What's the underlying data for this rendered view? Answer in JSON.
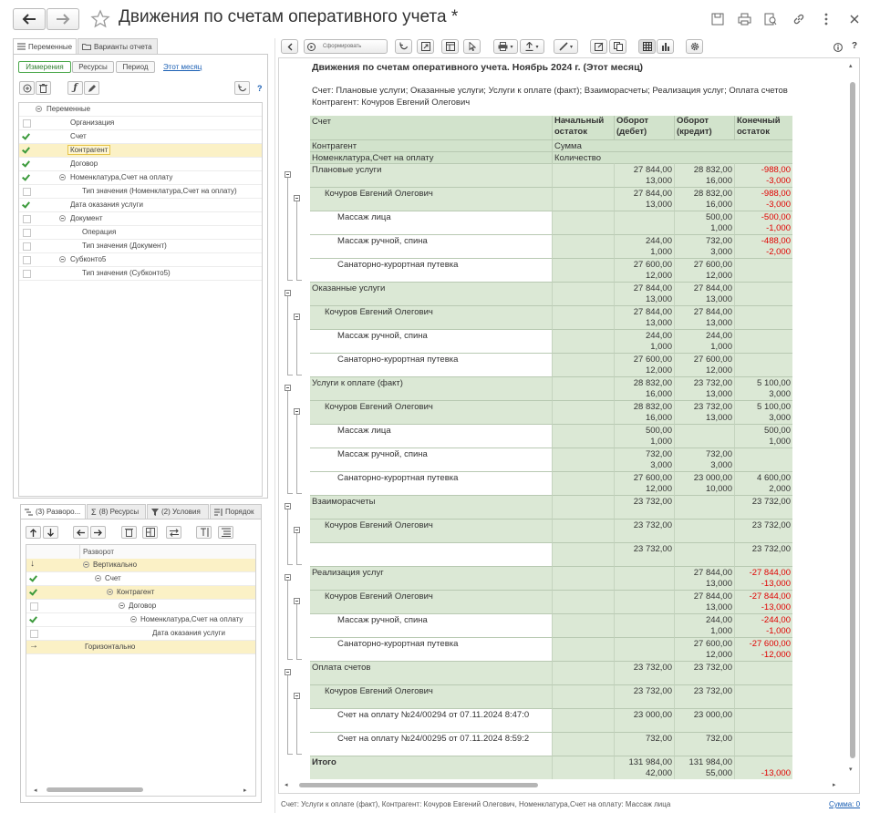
{
  "window": {
    "title": "Движения по счетам оперативного учета *"
  },
  "left_panel": {
    "tabs": [
      "Переменные",
      "Варианты отчета"
    ],
    "subtabs": [
      "Измерения",
      "Ресурсы",
      "Период"
    ],
    "period_link": "Этот месяц",
    "help": "?",
    "tree": [
      {
        "label": "Переменные",
        "level": 0,
        "checked": null,
        "group": true
      },
      {
        "label": "Организация",
        "level": 1,
        "checked": false
      },
      {
        "label": "Счет",
        "level": 1,
        "checked": true
      },
      {
        "label": "Контрагент",
        "level": 1,
        "checked": true,
        "highlight": true
      },
      {
        "label": "Договор",
        "level": 1,
        "checked": true
      },
      {
        "label": "Номенклатура,Счет на оплату",
        "level": 1,
        "checked": true,
        "group": true
      },
      {
        "label": "Тип значения (Номенклатура,Счет на оплату)",
        "level": 2,
        "checked": false
      },
      {
        "label": "Дата оказания услуги",
        "level": 1,
        "checked": true
      },
      {
        "label": "Документ",
        "level": 1,
        "checked": false,
        "group": true
      },
      {
        "label": "Операция",
        "level": 2,
        "checked": false
      },
      {
        "label": "Тип значения (Документ)",
        "level": 2,
        "checked": false
      },
      {
        "label": "Субконто5",
        "level": 1,
        "checked": false,
        "group": true
      },
      {
        "label": "Тип значения (Субконто5)",
        "level": 2,
        "checked": false
      }
    ],
    "bottom_tabs": [
      "(3) Разворо...",
      "(8) Ресурсы",
      "(2) Условия",
      "Порядок"
    ],
    "layout_header": "Разворот",
    "layout_tree": [
      {
        "label": "Вертикально",
        "level": 0,
        "mark": "arrow-down",
        "highlight": true
      },
      {
        "label": "Счет",
        "level": 1,
        "mark": "check"
      },
      {
        "label": "Контрагент",
        "level": 2,
        "mark": "check",
        "highlight": true
      },
      {
        "label": "Договор",
        "level": 3,
        "mark": "empty"
      },
      {
        "label": "Номенклатура,Счет на оплату",
        "level": 4,
        "mark": "check"
      },
      {
        "label": "Дата оказания услуги",
        "level": 5,
        "mark": "empty"
      },
      {
        "label": "Горизонтально",
        "level": 0,
        "mark": "arrow-right",
        "highlight": true
      }
    ]
  },
  "toolbar": {
    "generate_label": "Сформировать"
  },
  "report": {
    "title": "Движения по счетам оперативного учета. Ноябрь 2024 г. (Этот месяц)",
    "info_line1": "Счет: Плановые услуги; Оказанные услуги; Услуги к оплате (факт); Взаиморасчеты; Реализация услуг; Оплата счетов",
    "info_line2": "Контрагент: Кочуров Евгений Олегович",
    "headers": {
      "col1": "Счет",
      "col2": "Начальный остаток",
      "col3": "Оборот (дебет)",
      "col4": "Оборот (кредит)",
      "col5": "Конечный остаток",
      "row2_left": "Контрагент",
      "row2_right": "Сумма",
      "row3_left": "Номенклатура,Счет на оплату",
      "row3_right": "Количество"
    },
    "rows": [
      {
        "label": "Плановые услуги",
        "level": 0,
        "sum": [
          "",
          "27 844,00",
          "28 832,00",
          "-988,00"
        ],
        "qty": [
          "",
          "13,000",
          "16,000",
          "-3,000"
        ]
      },
      {
        "label": "Кочуров Евгений Олегович",
        "level": 1,
        "sum": [
          "",
          "27 844,00",
          "28 832,00",
          "-988,00"
        ],
        "qty": [
          "",
          "13,000",
          "16,000",
          "-3,000"
        ]
      },
      {
        "label": "Массаж лица",
        "level": 2,
        "sum": [
          "",
          "",
          "500,00",
          "-500,00"
        ],
        "qty": [
          "",
          "",
          "1,000",
          "-1,000"
        ]
      },
      {
        "label": "Массаж ручной, спина",
        "level": 2,
        "sum": [
          "",
          "244,00",
          "732,00",
          "-488,00"
        ],
        "qty": [
          "",
          "1,000",
          "3,000",
          "-2,000"
        ]
      },
      {
        "label": "Санаторно-курортная путевка",
        "level": 2,
        "sum": [
          "",
          "27 600,00",
          "27 600,00",
          ""
        ],
        "qty": [
          "",
          "12,000",
          "12,000",
          ""
        ]
      },
      {
        "label": "Оказанные услуги",
        "level": 0,
        "sum": [
          "",
          "27 844,00",
          "27 844,00",
          ""
        ],
        "qty": [
          "",
          "13,000",
          "13,000",
          ""
        ]
      },
      {
        "label": "Кочуров Евгений Олегович",
        "level": 1,
        "sum": [
          "",
          "27 844,00",
          "27 844,00",
          ""
        ],
        "qty": [
          "",
          "13,000",
          "13,000",
          ""
        ]
      },
      {
        "label": "Массаж ручной, спина",
        "level": 2,
        "sum": [
          "",
          "244,00",
          "244,00",
          ""
        ],
        "qty": [
          "",
          "1,000",
          "1,000",
          ""
        ]
      },
      {
        "label": "Санаторно-курортная путевка",
        "level": 2,
        "sum": [
          "",
          "27 600,00",
          "27 600,00",
          ""
        ],
        "qty": [
          "",
          "12,000",
          "12,000",
          ""
        ]
      },
      {
        "label": "Услуги к оплате (факт)",
        "level": 0,
        "sum": [
          "",
          "28 832,00",
          "23 732,00",
          "5 100,00"
        ],
        "qty": [
          "",
          "16,000",
          "13,000",
          "3,000"
        ]
      },
      {
        "label": "Кочуров Евгений Олегович",
        "level": 1,
        "sum": [
          "",
          "28 832,00",
          "23 732,00",
          "5 100,00"
        ],
        "qty": [
          "",
          "16,000",
          "13,000",
          "3,000"
        ]
      },
      {
        "label": "Массаж лица",
        "level": 2,
        "sum": [
          "",
          "500,00",
          "",
          "500,00"
        ],
        "qty": [
          "",
          "1,000",
          "",
          "1,000"
        ]
      },
      {
        "label": "Массаж ручной, спина",
        "level": 2,
        "sum": [
          "",
          "732,00",
          "732,00",
          ""
        ],
        "qty": [
          "",
          "3,000",
          "3,000",
          ""
        ]
      },
      {
        "label": "Санаторно-курортная путевка",
        "level": 2,
        "sum": [
          "",
          "27 600,00",
          "23 000,00",
          "4 600,00"
        ],
        "qty": [
          "",
          "12,000",
          "10,000",
          "2,000"
        ]
      },
      {
        "label": "Взаиморасчеты",
        "level": 0,
        "sum": [
          "",
          "23 732,00",
          "",
          "23 732,00"
        ],
        "qty": [
          "",
          "",
          "",
          ""
        ]
      },
      {
        "label": "Кочуров Евгений Олегович",
        "level": 1,
        "sum": [
          "",
          "23 732,00",
          "",
          "23 732,00"
        ],
        "qty": [
          "",
          "",
          "",
          ""
        ]
      },
      {
        "label": "",
        "level": 2,
        "sum": [
          "",
          "23 732,00",
          "",
          "23 732,00"
        ],
        "qty": [
          "",
          "",
          "",
          ""
        ]
      },
      {
        "label": "Реализация услуг",
        "level": 0,
        "sum": [
          "",
          "",
          "27 844,00",
          "-27 844,00"
        ],
        "qty": [
          "",
          "",
          "13,000",
          "-13,000"
        ]
      },
      {
        "label": "Кочуров Евгений Олегович",
        "level": 1,
        "sum": [
          "",
          "",
          "27 844,00",
          "-27 844,00"
        ],
        "qty": [
          "",
          "",
          "13,000",
          "-13,000"
        ]
      },
      {
        "label": "Массаж ручной, спина",
        "level": 2,
        "sum": [
          "",
          "",
          "244,00",
          "-244,00"
        ],
        "qty": [
          "",
          "",
          "1,000",
          "-1,000"
        ]
      },
      {
        "label": "Санаторно-курортная путевка",
        "level": 2,
        "sum": [
          "",
          "",
          "27 600,00",
          "-27 600,00"
        ],
        "qty": [
          "",
          "",
          "12,000",
          "-12,000"
        ]
      },
      {
        "label": "Оплата счетов",
        "level": 0,
        "sum": [
          "",
          "23 732,00",
          "23 732,00",
          ""
        ],
        "qty": [
          "",
          "",
          "",
          ""
        ]
      },
      {
        "label": "Кочуров Евгений Олегович",
        "level": 1,
        "sum": [
          "",
          "23 732,00",
          "23 732,00",
          ""
        ],
        "qty": [
          "",
          "",
          "",
          ""
        ]
      },
      {
        "label": "Счет на оплату №24/00294 от 07.11.2024 8:47:0",
        "level": 2,
        "sum": [
          "",
          "23 000,00",
          "23 000,00",
          ""
        ],
        "qty": [
          "",
          "",
          "",
          ""
        ]
      },
      {
        "label": "Счет на оплату №24/00295 от 07.11.2024 8:59:2",
        "level": 2,
        "sum": [
          "",
          "732,00",
          "732,00",
          ""
        ],
        "qty": [
          "",
          "",
          "",
          ""
        ]
      },
      {
        "label": "Итого",
        "level": 0,
        "total": true,
        "sum": [
          "",
          "131 984,00",
          "131 984,00",
          ""
        ],
        "qty": [
          "",
          "42,000",
          "55,000",
          "-13,000"
        ]
      }
    ]
  },
  "status_bar": {
    "text": "Счет: Услуги к оплате (факт), Контрагент: Кочуров Евгений Олегович, Номенклатура,Счет на оплату: Массаж лица",
    "sum_link": "Сумма: 0"
  },
  "colors": {
    "accent_green": "#4ca84c",
    "row_green": "#dbe8d5",
    "negative": "#e00000",
    "highlight": "#fbf1c6"
  }
}
